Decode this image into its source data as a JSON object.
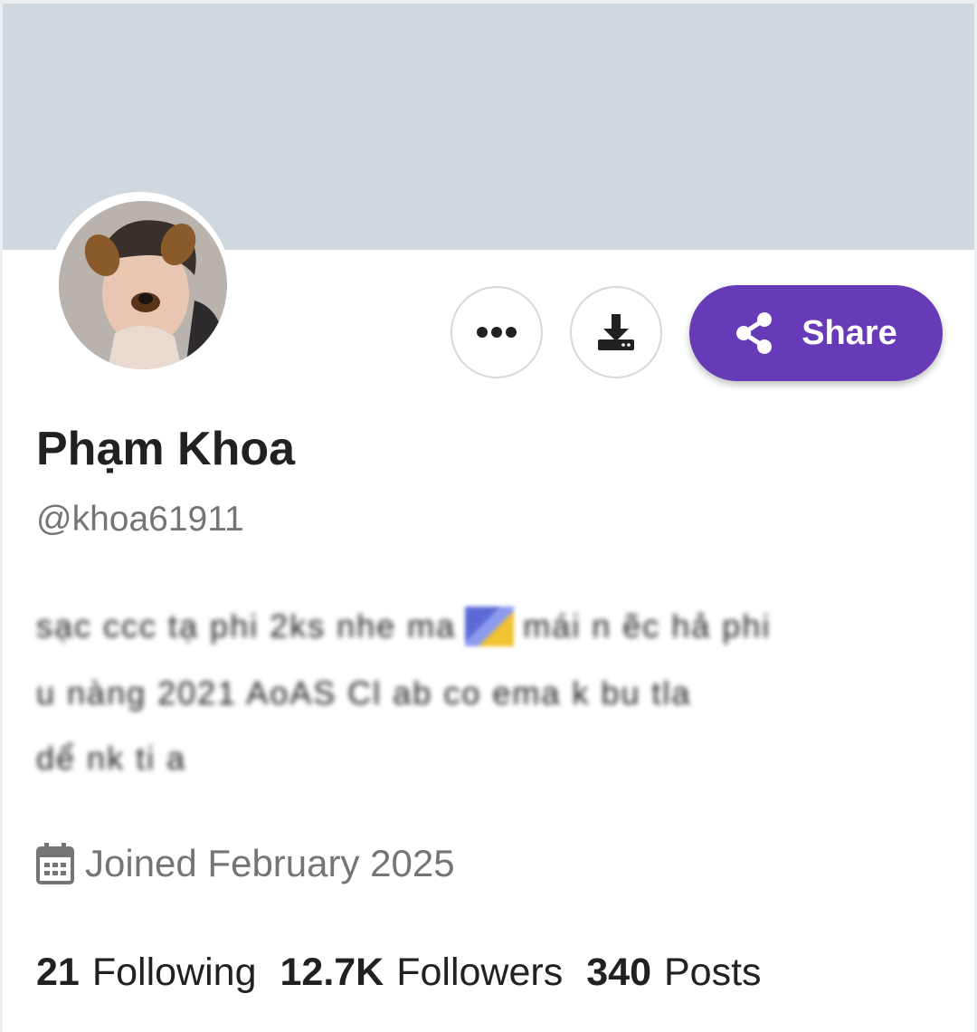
{
  "profile": {
    "name": "Phạm Khoa",
    "handle": "@khoa61911",
    "bio_lines": [
      "sạc ccc tạ phi 2ks nhe ma",
      "mái n ẽc hả phi",
      "u nàng 2021 AoAS Cl ab co ema k bu tla",
      "dể nk ti a"
    ],
    "joined": "Joined February 2025"
  },
  "actions": {
    "more_icon": "more-horizontal-icon",
    "download_icon": "download-icon",
    "share_label": "Share",
    "share_icon": "share-icon"
  },
  "stats": {
    "following_count": "21",
    "following_label": "Following",
    "followers_count": "12.7K",
    "followers_label": "Followers",
    "posts_count": "340",
    "posts_label": "Posts"
  },
  "colors": {
    "banner": "#cfd8de",
    "accent": "#673ab7",
    "text_primary": "#212121",
    "text_secondary": "#757575"
  }
}
